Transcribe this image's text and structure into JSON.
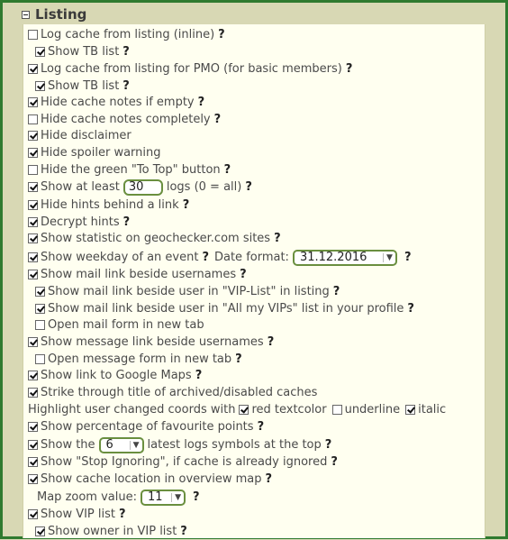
{
  "section": {
    "title": "Listing"
  },
  "rows": {
    "log_inline": {
      "label": "Log cache from listing (inline)",
      "checked": false
    },
    "show_tb_1": {
      "label": "Show TB list",
      "checked": true
    },
    "log_pmo": {
      "label": "Log cache from listing for PMO (for basic members)",
      "checked": true
    },
    "show_tb_2": {
      "label": "Show TB list",
      "checked": true
    },
    "hide_notes_empty": {
      "label": "Hide cache notes if empty",
      "checked": true
    },
    "hide_notes_completely": {
      "label": "Hide cache notes completely",
      "checked": false
    },
    "hide_disclaimer": {
      "label": "Hide disclaimer",
      "checked": true
    },
    "hide_spoiler": {
      "label": "Hide spoiler warning",
      "checked": true
    },
    "hide_top_button": {
      "label": "Hide the green \"To Top\" button",
      "checked": false
    },
    "show_at_least": {
      "label_pre": "Show at least",
      "value": "30",
      "label_post": "logs (0 = all)",
      "checked": true
    },
    "hide_hints": {
      "label": "Hide hints behind a link",
      "checked": true
    },
    "decrypt_hints": {
      "label": "Decrypt hints",
      "checked": true
    },
    "show_statistic": {
      "label": "Show statistic on geochecker.com sites",
      "checked": true
    },
    "show_weekday": {
      "label": "Show weekday of an event",
      "date_label": "Date format:",
      "date_value": "31.12.2016",
      "checked": true
    },
    "mail_link": {
      "label": "Show mail link beside usernames",
      "checked": true
    },
    "mail_vip_list": {
      "label": "Show mail link beside user in \"VIP-List\" in listing",
      "checked": true
    },
    "mail_all_vips": {
      "label": "Show mail link beside user in \"All my VIPs\" list in your profile",
      "checked": true
    },
    "mail_new_tab": {
      "label": "Open mail form in new tab",
      "checked": false
    },
    "message_link": {
      "label": "Show message link beside usernames",
      "checked": true
    },
    "message_new_tab": {
      "label": "Open message form in new tab",
      "checked": false
    },
    "google_maps": {
      "label": "Show link to Google Maps",
      "checked": true
    },
    "strike_archived": {
      "label": "Strike through title of archived/disabled caches",
      "checked": true
    },
    "highlight_coords": {
      "label": "Highlight user changed coords with",
      "red": "red textcolor",
      "underline": "underline",
      "italic": "italic",
      "red_checked": true,
      "underline_checked": false,
      "italic_checked": true
    },
    "fav_percentage": {
      "label": "Show percentage of favourite points",
      "checked": true
    },
    "latest_logs": {
      "label_pre": "Show the",
      "value": "6",
      "label_post": "latest logs symbols at the top",
      "checked": true
    },
    "stop_ignoring": {
      "label": "Show \"Stop Ignoring\", if cache is already ignored",
      "checked": true
    },
    "cache_location": {
      "label": "Show cache location in overview map",
      "checked": true
    },
    "map_zoom": {
      "label": "Map zoom value:",
      "value": "11"
    },
    "vip_list": {
      "label": "Show VIP list",
      "checked": true
    },
    "owner_vip": {
      "label": "Show owner in VIP list",
      "checked": true
    }
  },
  "help": "?"
}
